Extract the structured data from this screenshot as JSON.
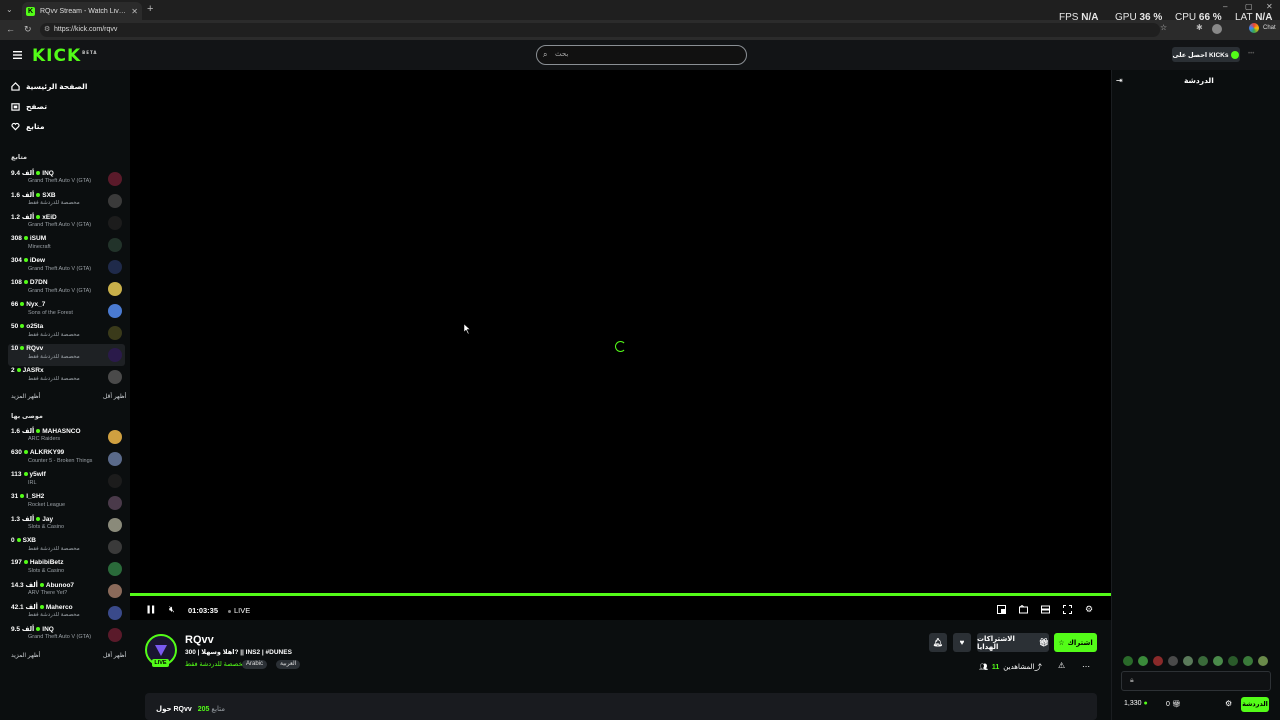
{
  "browser": {
    "tab_title": "RQvv Stream - Watch Live on Kick",
    "tab_favicon": "K",
    "url": "https://kick.com/rqvv",
    "extension_label": "Chat",
    "perf": {
      "fps_label": "FPS",
      "fps_value": "N/A",
      "gpu_label": "GPU",
      "gpu_value": "36 %",
      "cpu_label": "CPU",
      "cpu_value": "66 %",
      "lat_label": "LAT",
      "lat_value": "N/A"
    }
  },
  "header": {
    "logo": "KICK",
    "logo_beta": "BETA",
    "search_placeholder": "بحث",
    "kicks_button": "احصل على KICKs"
  },
  "sidebar": {
    "nav": [
      {
        "label": "الصفحة الرئيسية",
        "icon": "home-icon"
      },
      {
        "label": "تصفح",
        "icon": "browse-icon"
      },
      {
        "label": "متابع",
        "icon": "heart-icon"
      }
    ],
    "following_title": "متابع",
    "following": [
      {
        "viewers": "9.4 ألف",
        "name": "INQ",
        "game": "Grand Theft Auto V (GTA)",
        "color": "#5a1a2a"
      },
      {
        "viewers": "1.6 ألف",
        "name": "SXB",
        "game": "مخصصة للدردشة فقط",
        "color": "#3a3a3a"
      },
      {
        "viewers": "1.2 ألف",
        "name": "xEiD",
        "game": "Grand Theft Auto V (GTA)",
        "color": "#1c1c1c"
      },
      {
        "viewers": "308",
        "name": "iSUM",
        "game": "Minecraft",
        "color": "#22332a"
      },
      {
        "viewers": "304",
        "name": "iDew",
        "game": "Grand Theft Auto V (GTA)",
        "color": "#1f2a4a"
      },
      {
        "viewers": "108",
        "name": "D7DN",
        "game": "Grand Theft Auto V (GTA)",
        "color": "#c9b04a"
      },
      {
        "viewers": "66",
        "name": "Nyx_7",
        "game": "Sons of the Forest",
        "color": "#4a7ad0"
      },
      {
        "viewers": "50",
        "name": "o25ta",
        "game": "مخصصة للدردشة فقط",
        "color": "#3a3a1a"
      },
      {
        "viewers": "10",
        "name": "RQvv",
        "game": "مخصصة للدردشة فقط",
        "color": "#2a1a4a"
      },
      {
        "viewers": "2",
        "name": "JASRx",
        "game": "مخصصة للدردشة فقط",
        "color": "#4a4a4a"
      }
    ],
    "show_more": "أظهر المزيد",
    "show_less": "أظهر أقل",
    "recommended_title": "موصى بها",
    "recommended": [
      {
        "viewers": "1.6 ألف",
        "name": "MAHASNCO",
        "game": "ARC Raiders",
        "color": "#d0a040"
      },
      {
        "viewers": "630",
        "name": "ALKRKY99",
        "game": "Counter 5 - Broken Things",
        "color": "#5a6a8a"
      },
      {
        "viewers": "113",
        "name": "y5wlf",
        "game": "IRL",
        "color": "#1c1c1c"
      },
      {
        "viewers": "31",
        "name": "I_SH2",
        "game": "Rocket League",
        "color": "#4a3a4a"
      },
      {
        "viewers": "1.3 ألف",
        "name": "Jay",
        "game": "Slots & Casino",
        "color": "#8a8a7a"
      },
      {
        "viewers": "0",
        "name": "SXB",
        "game": "مخصصة للدردشة فقط",
        "color": "#3a3a3a"
      },
      {
        "viewers": "197",
        "name": "HabibiBetz",
        "game": "Slots & Casino",
        "color": "#2a6a3a"
      },
      {
        "viewers": "14.3 ألف",
        "name": "Abunoo7",
        "game": "ARV There Yet?",
        "color": "#8a6a5a"
      },
      {
        "viewers": "42.1 ألف",
        "name": "Maherco",
        "game": "مخصصة للدردشة فقط",
        "color": "#3a4a8a"
      },
      {
        "viewers": "9.5 ألف",
        "name": "INQ",
        "game": "Grand Theft Auto V (GTA)",
        "color": "#5a1a2a"
      }
    ]
  },
  "player": {
    "time": "01:03:35",
    "live_label": "LIVE"
  },
  "stream": {
    "name": "RQvv",
    "live_badge": "LIVE",
    "title": "اهلا وسهلا | 300? || INS2 | #DUNES",
    "category": "مخصصة للدردشة فقط",
    "tags": [
      "Arabic",
      "العربية"
    ],
    "subscribe_label": "اشتراك",
    "gift_label": "الاشتراكات الهدايا",
    "viewers_label": "المشاهدين",
    "viewers_count": "11"
  },
  "about": {
    "prefix": "حول",
    "name": "RQvv",
    "followers_count": "205",
    "followers_label": "متابع"
  },
  "chat": {
    "title": "الدردشة",
    "send_label": "الدردشة",
    "kicks_count": "1,330",
    "sub_count": "0"
  },
  "colors": {
    "accent": "#53fc18",
    "background": "#0b0e0f",
    "panel": "#191b1f"
  }
}
